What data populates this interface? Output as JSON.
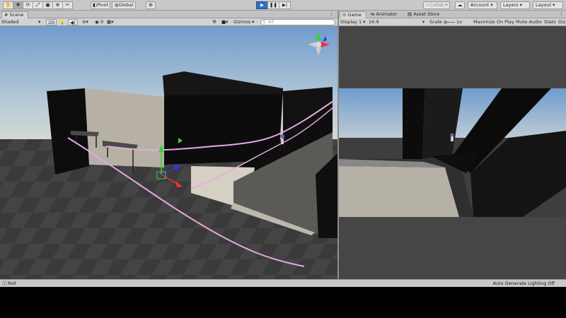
{
  "toolbar": {
    "pivot": "Pivot",
    "global": "Global",
    "collab": "Collab",
    "account": "Account",
    "layers": "Layers",
    "layout": "Layout"
  },
  "scene_tab": {
    "label": "Scene"
  },
  "scene_bar": {
    "shading": "Shaded",
    "mode_2d": "2D",
    "fx_count": "0",
    "gizmos": "Gizmos",
    "search_placeholder": "All"
  },
  "game_tabs": {
    "game": "Game",
    "animator": "Animator",
    "asset_store": "Asset Store"
  },
  "game_bar": {
    "display": "Display 1",
    "aspect": "16:9",
    "scale_label": "Scale",
    "scale_value": "1x",
    "maximize": "Maximize On Play",
    "mute": "Mute Audio",
    "stats": "Stats",
    "gizmos": "Giz"
  },
  "status": {
    "left": "Roll",
    "right": "Auto Generate Lighting Off"
  },
  "colors": {
    "play_blue": "#2f6fc8",
    "rail_pink": "#e7a8e0",
    "sky": "#7aa3cf"
  }
}
